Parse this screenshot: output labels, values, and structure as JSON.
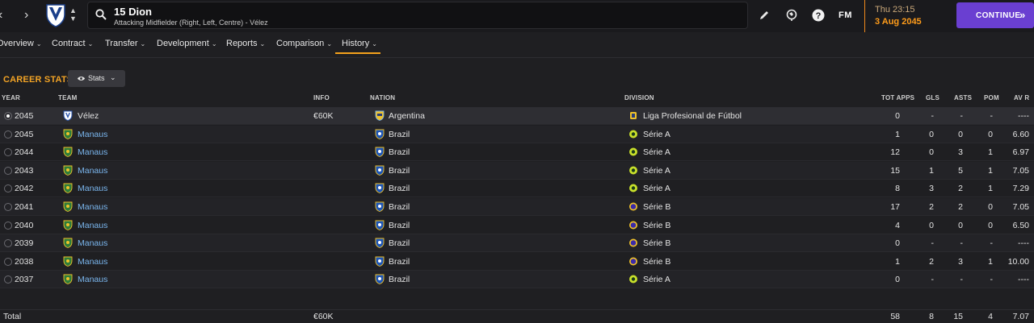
{
  "header": {
    "player_name": "15 Dion",
    "player_subtitle": "Attacking Midfielder (Right, Left, Centre) - Vélez",
    "fm_logo": "FM",
    "date_day": "Thu 23:15",
    "date_full": "3 Aug 2045",
    "continue_label": "CONTINUE",
    "icons": [
      "back-icon",
      "forward-icon",
      "club-crest-icon",
      "search-icon",
      "edit-icon",
      "globe-icon",
      "help-icon"
    ]
  },
  "tabs": [
    {
      "label": "Overview"
    },
    {
      "label": "Contract"
    },
    {
      "label": "Transfer"
    },
    {
      "label": "Development"
    },
    {
      "label": "Reports"
    },
    {
      "label": "Comparison"
    },
    {
      "label": "History",
      "active": true
    }
  ],
  "section": {
    "title": "CAREER STATS",
    "stats_button": "Stats"
  },
  "columns": {
    "year": "YEAR",
    "team": "TEAM",
    "info": "INFO",
    "nation": "NATION",
    "division": "DIVISION",
    "tot_apps": "TOT APPS",
    "gls": "GLS",
    "asts": "ASTS",
    "pom": "POM",
    "av_r": "AV R"
  },
  "rows": [
    {
      "year": "2045",
      "team": "Vélez",
      "info": "€60K",
      "nation": "Argentina",
      "division": "Liga Profesional de Fútbol",
      "tot_apps": "0",
      "gls": "-",
      "asts": "-",
      "pom": "-",
      "av_r": "----"
    },
    {
      "year": "2045",
      "team": "Manaus",
      "info": "",
      "nation": "Brazil",
      "division": "Série A",
      "tot_apps": "1",
      "gls": "0",
      "asts": "0",
      "pom": "0",
      "av_r": "6.60"
    },
    {
      "year": "2044",
      "team": "Manaus",
      "info": "",
      "nation": "Brazil",
      "division": "Série A",
      "tot_apps": "12",
      "gls": "0",
      "asts": "3",
      "pom": "1",
      "av_r": "6.97"
    },
    {
      "year": "2043",
      "team": "Manaus",
      "info": "",
      "nation": "Brazil",
      "division": "Série A",
      "tot_apps": "15",
      "gls": "1",
      "asts": "5",
      "pom": "1",
      "av_r": "7.05"
    },
    {
      "year": "2042",
      "team": "Manaus",
      "info": "",
      "nation": "Brazil",
      "division": "Série A",
      "tot_apps": "8",
      "gls": "3",
      "asts": "2",
      "pom": "1",
      "av_r": "7.29"
    },
    {
      "year": "2041",
      "team": "Manaus",
      "info": "",
      "nation": "Brazil",
      "division": "Série B",
      "tot_apps": "17",
      "gls": "2",
      "asts": "2",
      "pom": "0",
      "av_r": "7.05"
    },
    {
      "year": "2040",
      "team": "Manaus",
      "info": "",
      "nation": "Brazil",
      "division": "Série B",
      "tot_apps": "4",
      "gls": "0",
      "asts": "0",
      "pom": "0",
      "av_r": "6.50"
    },
    {
      "year": "2039",
      "team": "Manaus",
      "info": "",
      "nation": "Brazil",
      "division": "Série B",
      "tot_apps": "0",
      "gls": "-",
      "asts": "-",
      "pom": "-",
      "av_r": "----"
    },
    {
      "year": "2038",
      "team": "Manaus",
      "info": "",
      "nation": "Brazil",
      "division": "Série B",
      "tot_apps": "1",
      "gls": "2",
      "asts": "3",
      "pom": "1",
      "av_r": "10.00"
    },
    {
      "year": "2037",
      "team": "Manaus",
      "info": "",
      "nation": "Brazil",
      "division": "Série A",
      "tot_apps": "0",
      "gls": "-",
      "asts": "-",
      "pom": "-",
      "av_r": "----"
    }
  ],
  "total": {
    "label": "Total",
    "info": "€60K",
    "tot_apps": "58",
    "gls": "8",
    "asts": "15",
    "pom": "4",
    "av_r": "7.07"
  },
  "colors": {
    "accent": "#f5a21c",
    "continue": "#6a3fd1",
    "link": "#7ab6ee"
  }
}
